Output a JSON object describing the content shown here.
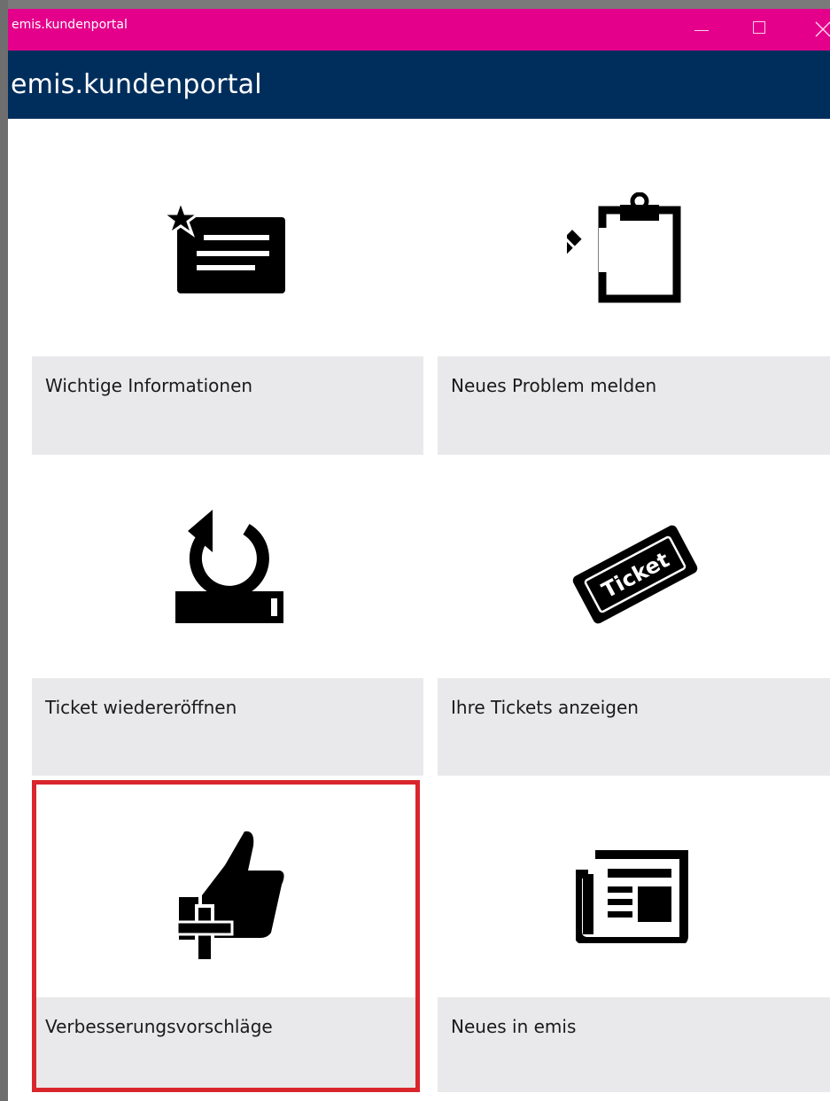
{
  "window": {
    "title": "emis.kundenportal",
    "controls": [
      "minimize",
      "maximize",
      "close"
    ]
  },
  "app": {
    "header": "emis.kundenportal"
  },
  "tiles": [
    {
      "label": "Wichtige Informationen",
      "icon": "news-star-icon"
    },
    {
      "label": "Neues Problem melden",
      "icon": "clipboard-pencil-icon"
    },
    {
      "label": "Ticket wiedereröffnen",
      "icon": "reopen-tray-icon"
    },
    {
      "label": "Ihre Tickets anzeigen",
      "icon": "ticket-icon"
    },
    {
      "label": "Verbesserungsvorschläge",
      "icon": "thumbs-up-plus-icon",
      "highlighted": true
    },
    {
      "label": "Neues in emis",
      "icon": "newspaper-icon"
    }
  ],
  "ticket_icon_text": "Ticket",
  "colors": {
    "titlebar": "#e4008a",
    "appbar": "#002e5c",
    "tile_label_bg": "#e9e9eb",
    "highlight_border": "#d9262d"
  }
}
